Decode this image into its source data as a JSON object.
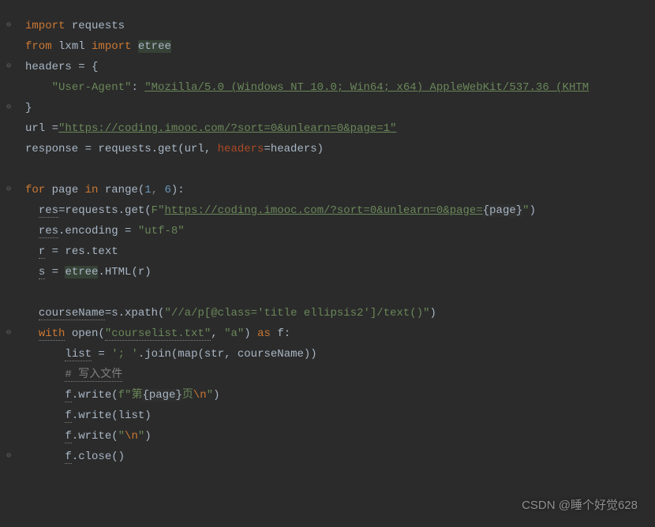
{
  "code": {
    "l1": {
      "kw1": "import",
      "mod": "requests"
    },
    "l2": {
      "kw1": "from",
      "mod": "lxml",
      "kw2": "import",
      "target": "etree"
    },
    "l3": {
      "var": "headers = {"
    },
    "l4": {
      "indent": "    ",
      "key": "\"User-Agent\"",
      "colon": ": ",
      "val": "\"Mozilla/5.0 (Windows NT 10.0; Win64; x64) AppleWebKit/537.36 (KHTM"
    },
    "l5": {
      "text": "}"
    },
    "l6": {
      "pre": "url =",
      "url": "\"https://coding.imooc.com/?sort=0&unlearn=0&page=1\""
    },
    "l7": {
      "pre": "response = requests.get(url, ",
      "param": "headers",
      "post": "=headers)"
    },
    "l8": {
      "text": ""
    },
    "l9": {
      "kw1": "for",
      "var": "page",
      "kw2": "in",
      "fn": "range(",
      "a": "1",
      "sep": ", ",
      "b": "6",
      "close": "):"
    },
    "l10": {
      "indent": "  ",
      "var": "res",
      "pre": "=requests.get(",
      "f": "F",
      "q": "\"",
      "url": "https://coding.imooc.com/?sort=0&unlearn=0&page=",
      "expr": "{page}",
      "q2": "\"",
      "close": ")"
    },
    "l11": {
      "indent": "  ",
      "var": "res",
      "post": ".encoding = ",
      "val": "\"utf-8\""
    },
    "l12": {
      "indent": "  ",
      "var": "r",
      "post": " = res.text"
    },
    "l13": {
      "indent": "  ",
      "var": "s",
      "eq": " = ",
      "etree": "etree",
      "post": ".HTML(r)"
    },
    "l14": {
      "text": ""
    },
    "l15": {
      "indent": "  ",
      "var": "courseName",
      "pre": "=s.xpath(",
      "str": "\"//a/p[@class='title ellipsis2']/text()\"",
      "close": ")"
    },
    "l16": {
      "indent": "  ",
      "kw": "with",
      "sp": " open(",
      "str": "\"courselist.txt\"",
      "comma": ", ",
      "mode": "\"a\"",
      "close": ") ",
      "kw2": "as",
      "post": " f:"
    },
    "l17": {
      "indent": "      ",
      "var": "list",
      "eq": " = ",
      "str": "'; '",
      "post": ".join(map(str, courseName))"
    },
    "l18": {
      "indent": "      ",
      "text": "# 写入文件"
    },
    "l19": {
      "indent": "      ",
      "var": "f",
      "pre": ".write(",
      "f": "f",
      "q": "\"",
      "zh": "第",
      "expr": "{page}",
      "zh2": "页",
      "esc": "\\n",
      "q2": "\"",
      "close": ")"
    },
    "l20": {
      "indent": "      ",
      "var": "f",
      "post": ".write(list)"
    },
    "l21": {
      "indent": "      ",
      "var": "f",
      "pre": ".write(",
      "str": "\"",
      "esc": "\\n",
      "str2": "\"",
      "close": ")"
    },
    "l22": {
      "indent": "      ",
      "var": "f",
      "post": ".close()"
    }
  },
  "watermark": "CSDN @睡个好觉628"
}
